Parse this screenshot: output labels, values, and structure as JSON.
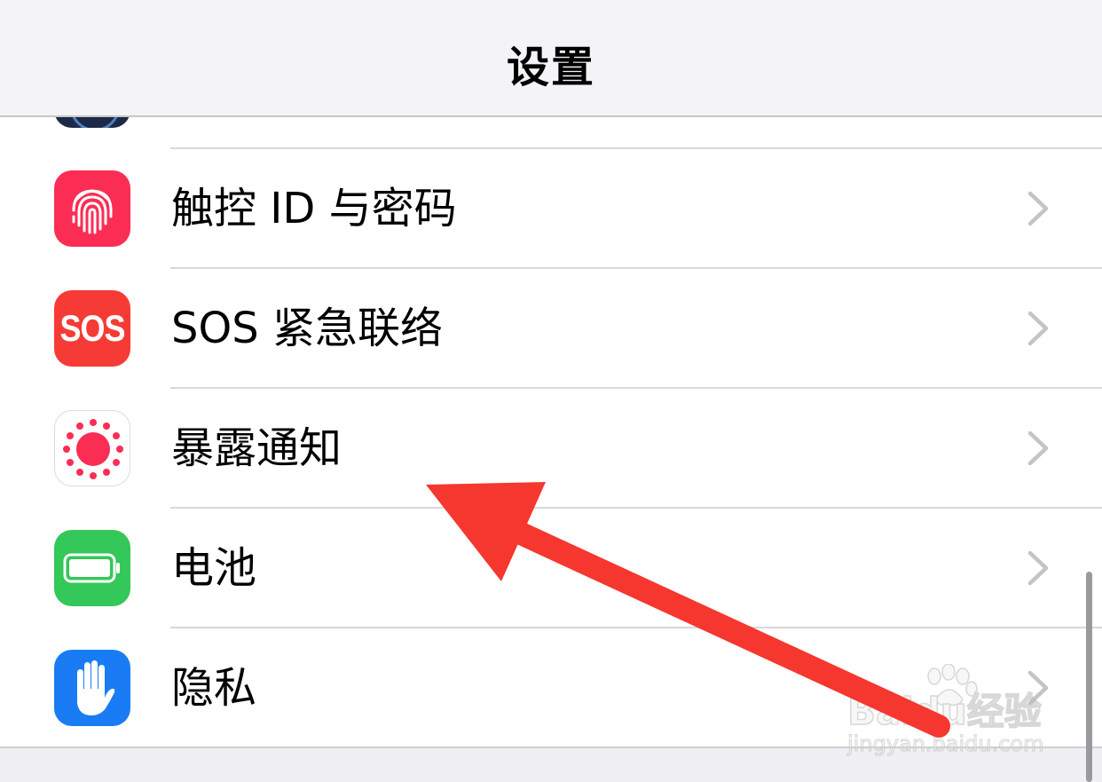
{
  "header": {
    "title": "设置"
  },
  "settings_items": [
    {
      "label": "触控 ID 与密码",
      "icon": "fingerprint-icon",
      "color": "#fb2d55"
    },
    {
      "label": "SOS 紧急联络",
      "icon": "sos-icon",
      "color": "#f63b36",
      "icon_text": "SOS"
    },
    {
      "label": "暴露通知",
      "icon": "exposure-notification-icon",
      "color": "#ffffff"
    },
    {
      "label": "电池",
      "icon": "battery-icon",
      "color": "#34c759"
    },
    {
      "label": "隐私",
      "icon": "privacy-hand-icon",
      "color": "#1a7cf5"
    }
  ],
  "annotation": {
    "arrow_color": "#f5372f"
  },
  "watermark": {
    "brand": "Baidu经验",
    "url": "jingyan.baidu.com"
  }
}
